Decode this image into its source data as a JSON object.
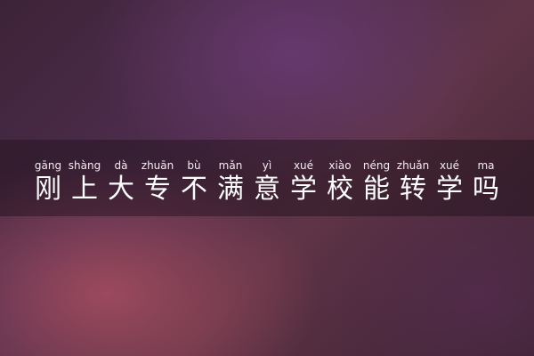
{
  "title": {
    "chars": [
      {
        "pinyin": "gāng",
        "hanzi": "刚"
      },
      {
        "pinyin": "shàng",
        "hanzi": "上"
      },
      {
        "pinyin": "dà",
        "hanzi": "大"
      },
      {
        "pinyin": "zhuān",
        "hanzi": "专"
      },
      {
        "pinyin": "bù",
        "hanzi": "不"
      },
      {
        "pinyin": "mǎn",
        "hanzi": "满"
      },
      {
        "pinyin": "yì",
        "hanzi": "意"
      },
      {
        "pinyin": "xué",
        "hanzi": "学"
      },
      {
        "pinyin": "xiào",
        "hanzi": "校"
      },
      {
        "pinyin": "néng",
        "hanzi": "能"
      },
      {
        "pinyin": "zhuǎn",
        "hanzi": "转"
      },
      {
        "pinyin": "xué",
        "hanzi": "学"
      },
      {
        "pinyin": "ma",
        "hanzi": "吗"
      }
    ]
  }
}
